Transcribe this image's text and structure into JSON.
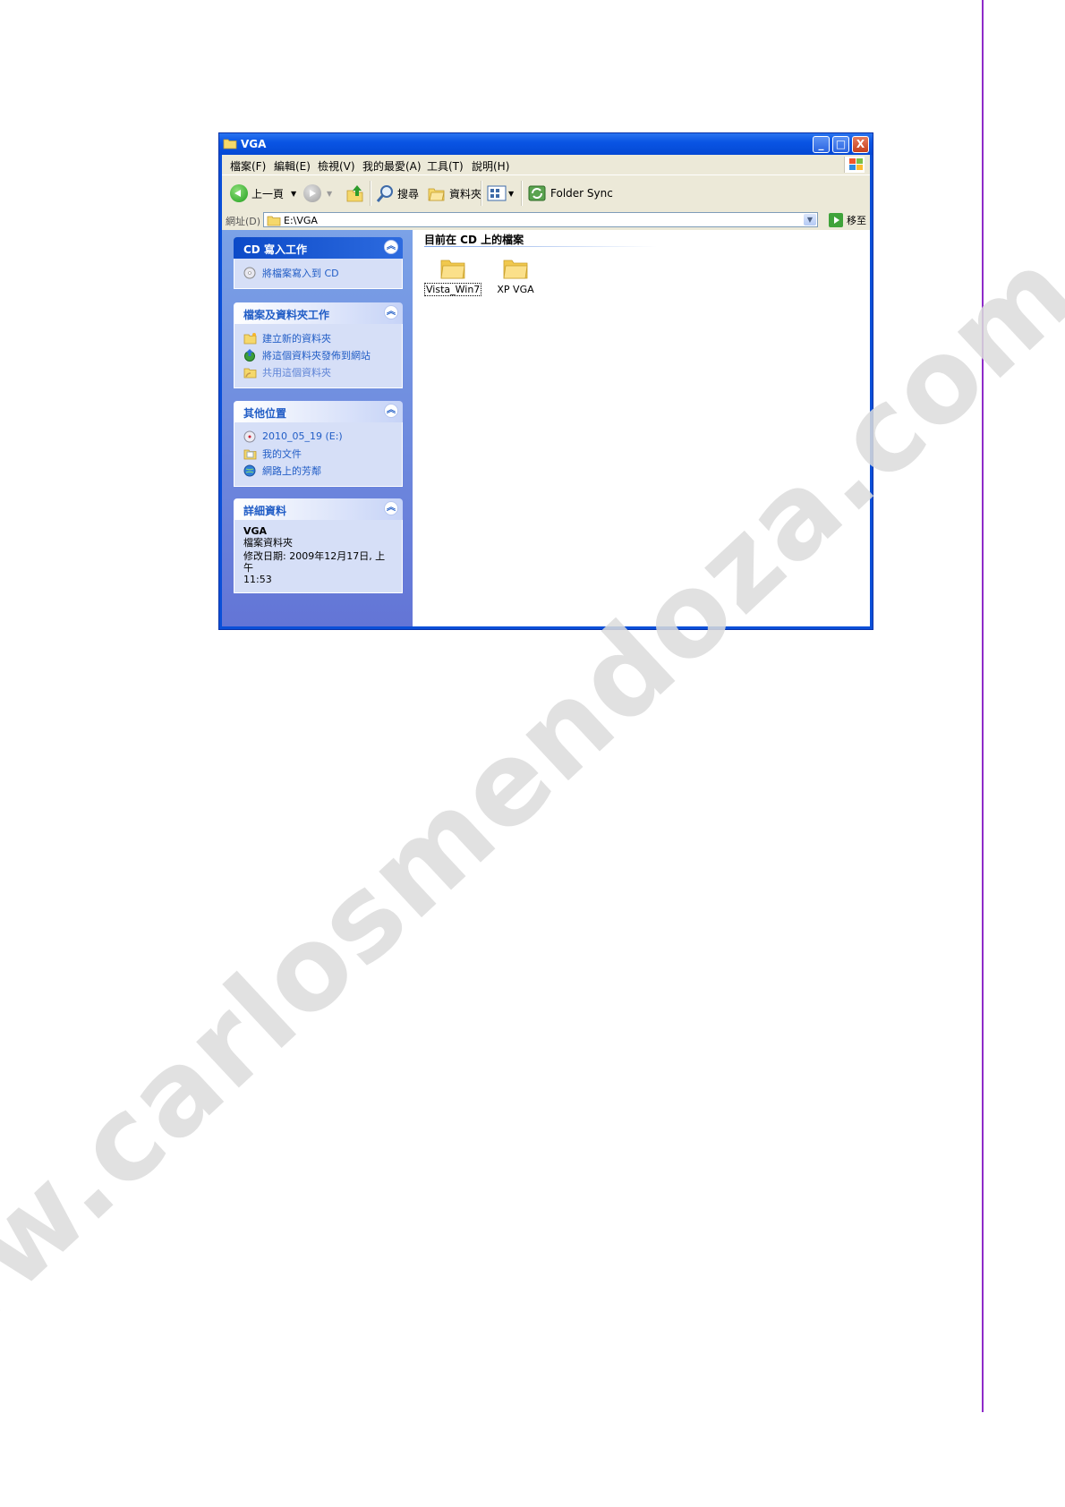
{
  "watermark": "www.carlosmendoza.com.mx",
  "window": {
    "title": "VGA",
    "controls": {
      "minimize": "_",
      "maximize": "□",
      "close": "X"
    }
  },
  "menubar": {
    "items": [
      "檔案(F)",
      "編輯(E)",
      "檢視(V)",
      "我的最愛(A)",
      "工具(T)",
      "說明(H)"
    ]
  },
  "toolbar": {
    "back_label": "上一頁",
    "search_label": "搜尋",
    "folders_label": "資料夾",
    "folder_sync_label": "Folder Sync"
  },
  "addressbar": {
    "label": "網址(D)",
    "value": "E:\\VGA",
    "go_label": "移至"
  },
  "taskpane": {
    "cd_panel": {
      "title": "CD 寫入工作",
      "tasks": [
        "將檔案寫入到 CD"
      ]
    },
    "file_panel": {
      "title": "檔案及資料夾工作",
      "tasks": [
        "建立新的資料夾",
        "將這個資料夾發佈到網站",
        "共用這個資料夾"
      ]
    },
    "places_panel": {
      "title": "其他位置",
      "items": [
        "2010_05_19 (E:)",
        "我的文件",
        "網路上的芳鄰"
      ]
    },
    "details_panel": {
      "title": "詳細資料",
      "name": "VGA",
      "type": "檔案資料夾",
      "modified_line1": "修改日期: 2009年12月17日, 上午",
      "modified_line2": "11:53"
    }
  },
  "content": {
    "group_title": "目前在 CD 上的檔案",
    "folders": [
      {
        "name": "Vista_Win7",
        "selected": true
      },
      {
        "name": "XP VGA",
        "selected": false
      }
    ]
  },
  "colors": {
    "title_bar": "#0a55e4",
    "task_pane": "#7ba2e7",
    "side_rule": "#8e2bc9",
    "link": "#215dc6"
  }
}
